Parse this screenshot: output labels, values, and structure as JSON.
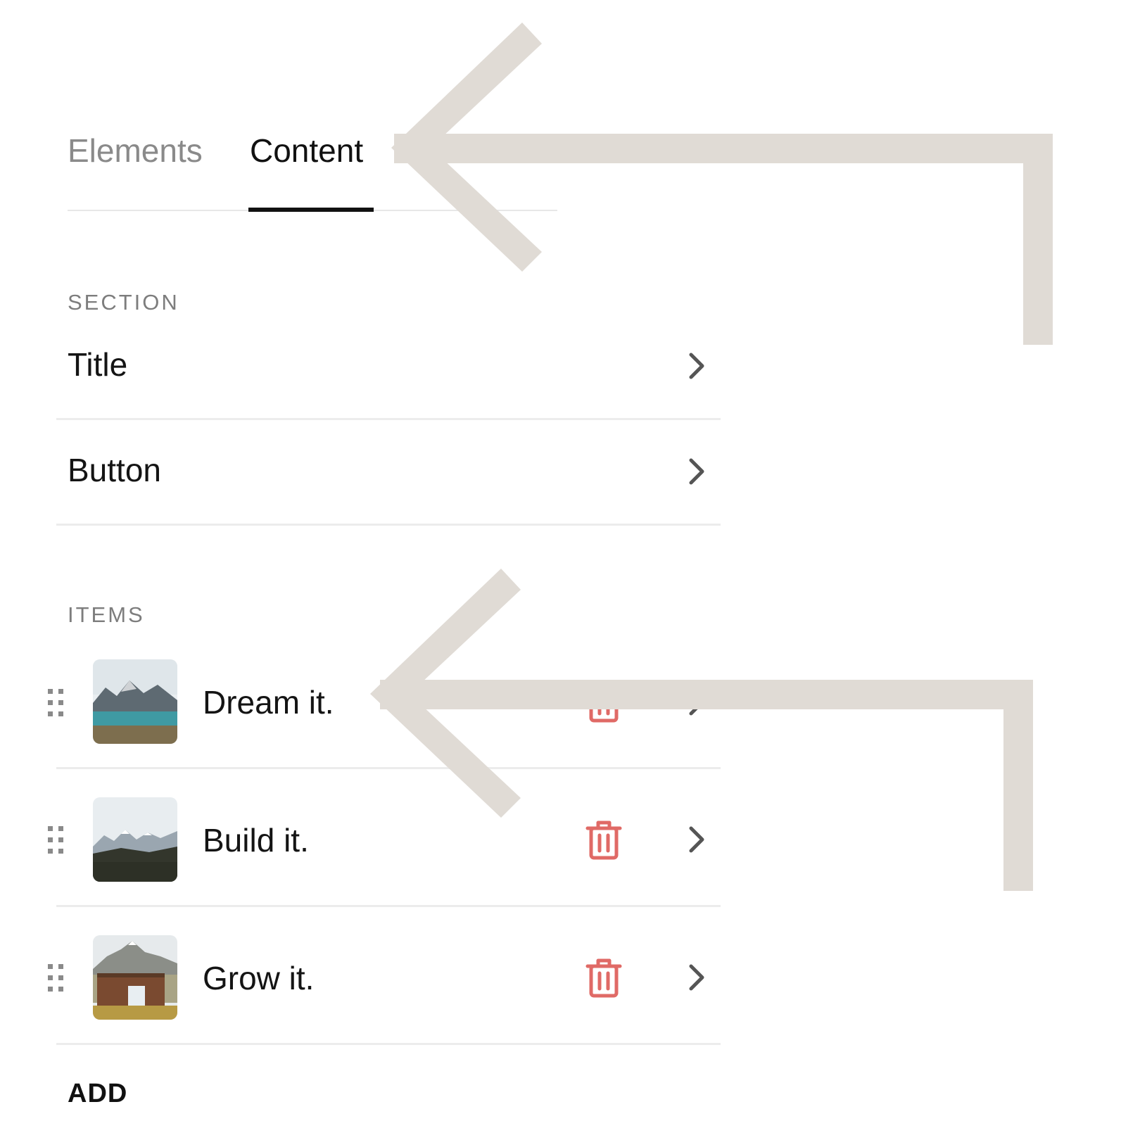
{
  "tabs": [
    {
      "label": "Elements",
      "active": false
    },
    {
      "label": "Content",
      "active": true
    }
  ],
  "section": {
    "heading": "SECTION",
    "rows": [
      {
        "label": "Title"
      },
      {
        "label": "Button"
      }
    ]
  },
  "items": {
    "heading": "ITEMS",
    "list": [
      {
        "label": "Dream it."
      },
      {
        "label": "Build it."
      },
      {
        "label": "Grow it."
      }
    ]
  },
  "add_label": "ADD",
  "colors": {
    "arrow": "#e0dbd5",
    "trash": "#e06a66",
    "chevron": "#555555",
    "active_tab_underline": "#111111"
  },
  "icons": [
    "drag-handle-icon",
    "trash-icon",
    "chevron-right-icon"
  ]
}
